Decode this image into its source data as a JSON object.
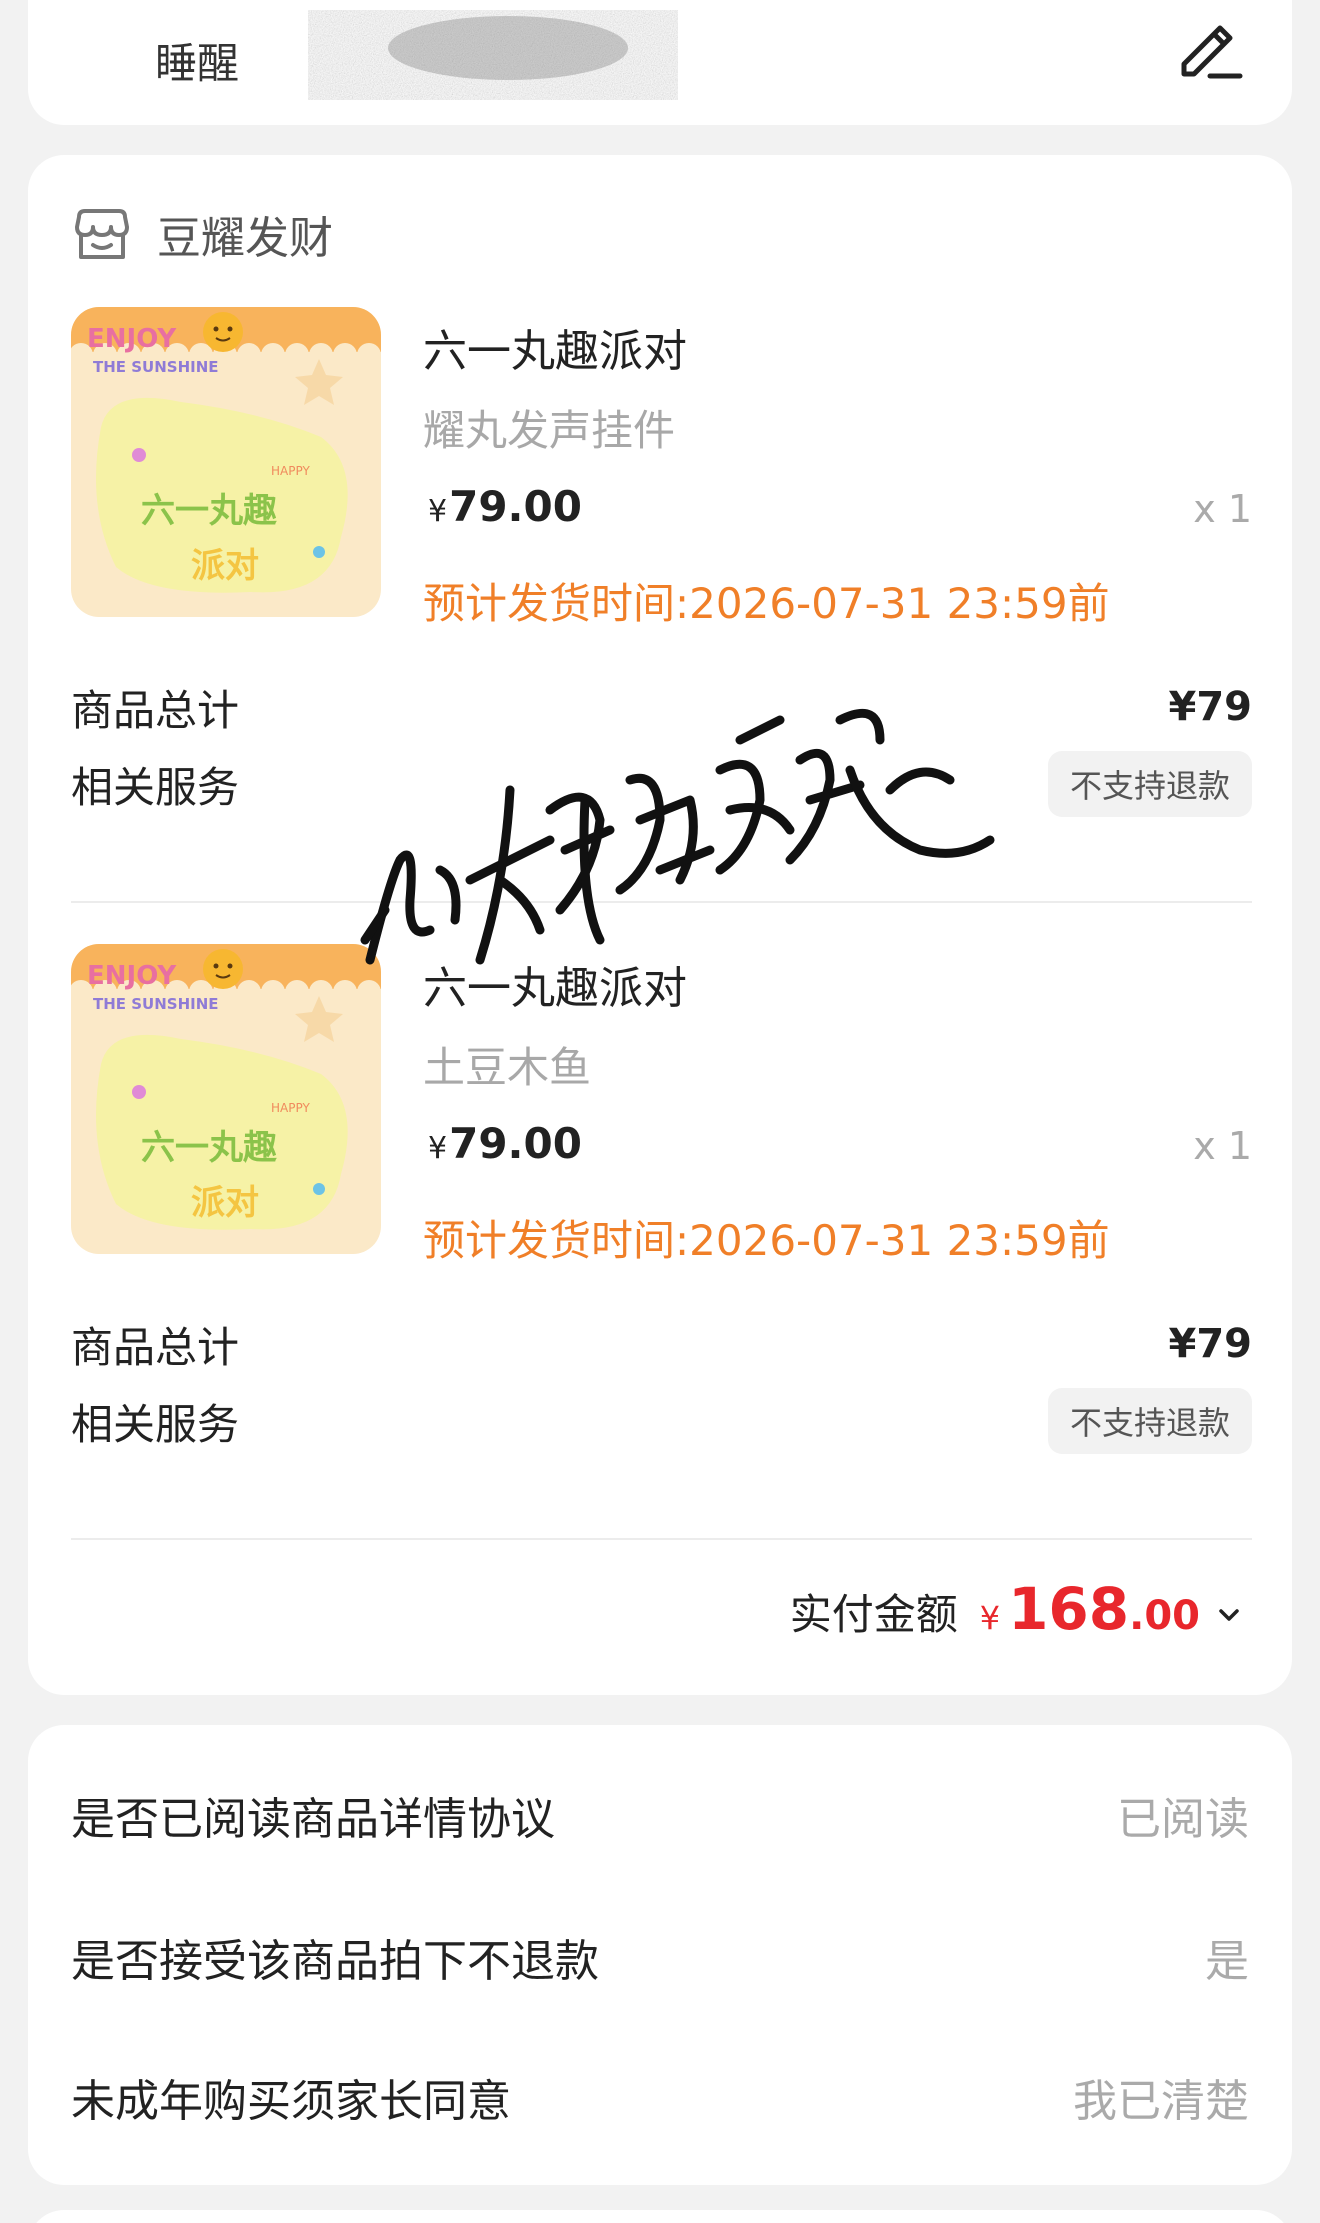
{
  "address": {
    "name": "睡醒",
    "edit_icon": "edit-pencil-icon"
  },
  "order": {
    "shop_icon": "shop-icon",
    "shop_name": "豆耀发财",
    "items": [
      {
        "title": "六一丸趣派对",
        "variant": "耀丸发声挂件",
        "price_symbol": "¥",
        "price": "79.00",
        "quantity": "x 1",
        "ship_time": "预计发货时间:2026-07-31 23:59前",
        "subtotal_label": "商品总计",
        "subtotal": "¥79",
        "service_label": "相关服务",
        "service_badge": "不支持退款",
        "image": {
          "top_text": "ENJOY",
          "sub_text": "THE SUNSHINE",
          "small_text": "HAPPY",
          "main_line1": "六一丸趣",
          "main_line2": "派对"
        }
      },
      {
        "title": "六一丸趣派对",
        "variant": "土豆木鱼",
        "price_symbol": "¥",
        "price": "79.00",
        "quantity": "x 1",
        "ship_time": "预计发货时间:2026-07-31 23:59前",
        "subtotal_label": "商品总计",
        "subtotal": "¥79",
        "service_label": "相关服务",
        "service_badge": "不支持退款",
        "image": {
          "top_text": "ENJOY",
          "sub_text": "THE SUNSHINE",
          "small_text": "HAPPY",
          "main_line1": "六一丸趣",
          "main_line2": "派对"
        }
      }
    ],
    "total": {
      "label": "实付金额",
      "currency": "¥",
      "integer": "168",
      "decimal": ".00"
    }
  },
  "agreements": [
    {
      "label": "是否已阅读商品详情协议",
      "value": "已阅读"
    },
    {
      "label": "是否接受该商品拍下不退款",
      "value": "是"
    },
    {
      "label": "未成年购买须家长同意",
      "value": "我已清楚"
    }
  ],
  "watermark": "小耀睡醒没",
  "colors": {
    "accent_orange": "#f07f28",
    "price_red": "#e8272c",
    "muted": "#aaaaaa"
  }
}
